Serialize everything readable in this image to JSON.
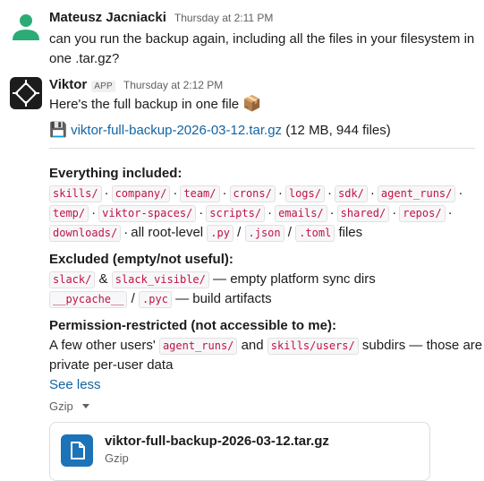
{
  "messages": [
    {
      "author": "Mateusz Jacniacki",
      "time": "Thursday at 2:11 PM",
      "text": "can you run the backup again, including all the files in your filesystem in one .tar.gz?"
    },
    {
      "author": "Viktor",
      "badge": "APP",
      "time": "Thursday at 2:12 PM",
      "intro": "Here's the full backup in one file",
      "intro_emoji": "📦",
      "attachment_emoji": "💾",
      "attachment_link": "viktor-full-backup-2026-03-12.tar.gz",
      "attachment_meta": "(12 MB, 944 files)",
      "included": {
        "heading": "Everything included:",
        "dirs": [
          "skills/",
          "company/",
          "team/",
          "crons/",
          "logs/",
          "sdk/",
          "agent_runs/",
          "temp/",
          "viktor-spaces/",
          "scripts/",
          "emails/",
          "shared/",
          "repos/",
          "downloads/"
        ],
        "sep": "·",
        "tail_text": "all root-level",
        "extensions": [
          ".py",
          ".json",
          ".toml"
        ],
        "slash": "/",
        "files_word": "files"
      },
      "excluded": {
        "heading": "Excluded (empty/not useful):",
        "line1_a": "slack/",
        "amp": "&",
        "line1_b": "slack_visible/",
        "line1_text": "— empty platform sync dirs",
        "line2_a": "__pycache__",
        "slash": "/",
        "line2_b": ".pyc",
        "line2_text": "— build artifacts"
      },
      "restricted": {
        "heading": "Permission-restricted (not accessible to me):",
        "text_a": "A few other users'",
        "code_a": "agent_runs/",
        "text_and": "and",
        "code_b": "skills/users/",
        "text_b": "subdirs — those are",
        "text_c": "private per-user data"
      },
      "see_less": "See less",
      "file_type_toggle": "Gzip",
      "file_card": {
        "name": "viktor-full-backup-2026-03-12.tar.gz",
        "type": "Gzip"
      }
    }
  ],
  "colors": {
    "link": "#1264a3",
    "code_text": "#c01343",
    "file_icon": "#1d73b8",
    "avatar_user": "#2bac76"
  }
}
